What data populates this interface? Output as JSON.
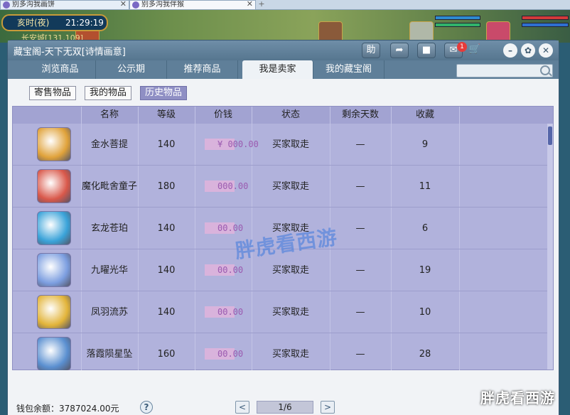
{
  "browser": {
    "tabs": [
      {
        "label": "别多沟我画饼"
      },
      {
        "label": "别多沟我伴猴"
      }
    ],
    "new_tab": "+"
  },
  "game": {
    "time_label": "亥时(夜)",
    "clock": "21:29:19",
    "location": "长安城[131,109]"
  },
  "window": {
    "title": "藏宝阁-天下无双[诗情画意]",
    "toolbar": {
      "help": "助",
      "notify_count": "1"
    },
    "nav_tabs": [
      "浏览商品",
      "公示期",
      "推荐商品",
      "我是卖家",
      "我的藏宝阁"
    ],
    "active_tab": "我是卖家",
    "search_placeholder": "",
    "sub_tabs": [
      "寄售物品",
      "我的物品",
      "历史物品"
    ],
    "active_sub_tab": "历史物品",
    "columns": [
      "名称",
      "等级",
      "价钱",
      "状态",
      "剩余天数",
      "收藏"
    ],
    "rows": [
      {
        "name": "金水菩提",
        "level": "140",
        "price": "¥ 000.00",
        "status": "买家取走",
        "days": "—",
        "fav": "9"
      },
      {
        "name": "魔化毗舍童子",
        "level": "180",
        "price": "000.00",
        "status": "买家取走",
        "days": "—",
        "fav": "11"
      },
      {
        "name": "玄龙苍珀",
        "level": "140",
        "price": "00.00",
        "status": "买家取走",
        "days": "—",
        "fav": "6"
      },
      {
        "name": "九曜光华",
        "level": "140",
        "price": "00.00",
        "status": "买家取走",
        "days": "—",
        "fav": "19"
      },
      {
        "name": "凤羽流苏",
        "level": "140",
        "price": "00.00",
        "status": "买家取走",
        "days": "—",
        "fav": "10"
      },
      {
        "name": "落霞陨星坠",
        "level": "160",
        "price": "00.00",
        "status": "买家取走",
        "days": "—",
        "fav": "28"
      }
    ],
    "wallet": "钱包余额：3787024.00元",
    "help_icon": "?",
    "page": "1/6",
    "prev": "<",
    "next": ">"
  },
  "watermark": {
    "center": "胖虎看西游",
    "corner": "胖虎看西游"
  },
  "colors": {
    "header_row": "#a2a3d2",
    "rows": "#b1b2dc",
    "accent": "#8f8fc4"
  }
}
